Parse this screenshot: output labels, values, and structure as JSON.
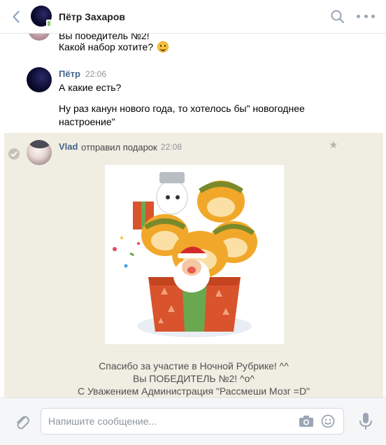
{
  "header": {
    "contact_name": "Пётр Захаров"
  },
  "messages": {
    "first_group": {
      "line1": "Вы победитель №2!",
      "line2": "Какой набор хотите?"
    },
    "petr": {
      "sender": "Пётр",
      "time": "22:06",
      "text1": "А какие есть?",
      "text2_line1": "Ну раз канун нового года, то хотелось бы\" новогоднее",
      "text2_line2": "настроение\""
    },
    "vlad": {
      "sender": "Vlad",
      "action": "отправил подарок",
      "time": "22:08",
      "caption_line1": "Спасибо за участие в Ночной Рубрике! ^^",
      "caption_line2": "Вы ПОБЕДИТЕЛЬ №2! ^о^",
      "caption_line3": "С Уважением Администрация \"Рассмеши Мозг =D\""
    }
  },
  "composer": {
    "placeholder": "Напишите сообщение..."
  },
  "icons": {
    "back": "chevron-left-icon",
    "search": "search-icon",
    "more": "more-icon",
    "star": "star-icon",
    "attach": "paperclip-icon",
    "camera": "camera-icon",
    "smile": "smile-icon",
    "mic": "microphone-icon"
  },
  "colors": {
    "accent": "#42648b",
    "gift_bg": "#f0ede2",
    "icon_gray": "#9aa6b3"
  }
}
